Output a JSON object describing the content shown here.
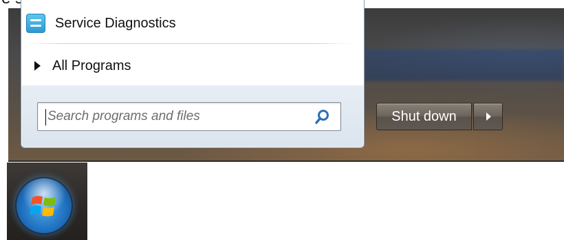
{
  "heading": {
    "text": "e start menu"
  },
  "start_menu": {
    "items": [
      {
        "label": "Service Diagnostics",
        "icon": "service-diagnostics-icon"
      },
      {
        "label": "All Programs",
        "icon": "triangle-right-icon"
      }
    ],
    "search": {
      "placeholder": "Search programs and files",
      "value": "",
      "icon": "search-icon"
    }
  },
  "power": {
    "shutdown_label": "Shut down",
    "options_icon": "arrow-right-icon"
  },
  "taskbar": {
    "start_button_icon": "windows-orb-icon"
  },
  "colors": {
    "menu_background": "#ffffff",
    "search_icon": "#2d6fb6",
    "shutdown_button": "#6b645c",
    "orb_blue": "#1f6fbe"
  }
}
